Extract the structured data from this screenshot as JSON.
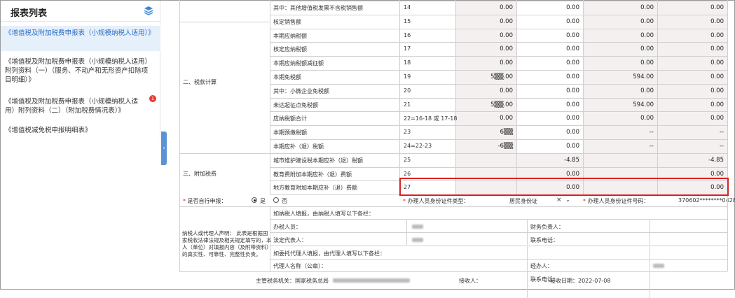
{
  "sidebar": {
    "title": "报表列表",
    "items": [
      {
        "label": "《增值税及附加税费申报表（小规模纳税人适用）》",
        "active": true
      },
      {
        "label": "《增值税及附加税费申报表（小规模纳税人适用）附列资料（一）（服务、不动产和无形资产扣除项目明细）》",
        "active": false
      },
      {
        "label": "《增值税及附加税费申报表（小规模纳税人适用）附列资料（二）（附加税费情况表）》",
        "active": false,
        "badge": "1"
      },
      {
        "label": "《增值税减免税申报明细表》",
        "active": false
      }
    ]
  },
  "form": {
    "rows": [
      {
        "label": "其中：其他增值税发票不含税销售额",
        "code": "14",
        "v1": "0.00",
        "v2": "0.00",
        "v3": "0.00",
        "v4": "0.00"
      },
      {
        "label": "核定销售额",
        "code": "15",
        "v1": "0.00",
        "v2": "0.00",
        "v3": "0.00",
        "v4": "0.00"
      },
      {
        "label": "本期应纳税额",
        "code": "16",
        "v1": "0.00",
        "v2": "0.00",
        "v3": "0.00",
        "v4": "0.00"
      },
      {
        "label": "核定应纳税额",
        "code": "17",
        "v1": "0.00",
        "v2": "0.00",
        "v3": "0.00",
        "v4": "0.00"
      },
      {
        "label": "本期应纳税额减征额",
        "code": "18",
        "v1": "0.00",
        "v2": "0.00",
        "v3": "0.00",
        "v4": "0.00"
      },
      {
        "label": "本期免税额",
        "code": "19",
        "v1": "5▒▒.00",
        "v2": "0.00",
        "v3": "594.00",
        "v4": "0.00"
      },
      {
        "label": "其中：小微企业免税额",
        "code": "20",
        "v1": "0.00",
        "v2": "0.00",
        "v3": "0.00",
        "v4": "0.00"
      },
      {
        "label": "未达起征点免税额",
        "code": "21",
        "v1": "5▒▒.00",
        "v2": "0.00",
        "v3": "594.00",
        "v4": "0.00"
      },
      {
        "label": "应纳税额合计",
        "code": "22=16-18 或 17-18",
        "v1": "0.00",
        "v2": "0.00",
        "v3": "0.00",
        "v4": "0.00"
      },
      {
        "label": "本期预缴税额",
        "code": "23",
        "v1": "6▒▒",
        "v2": "0.00",
        "v3": "--",
        "v4": "--"
      },
      {
        "label": "本期应补（退）税额",
        "code": "24=22-23",
        "v1": "-6▒▒",
        "v2": "0.00",
        "v3": "--",
        "v4": "--"
      }
    ],
    "section_tax": "二、税款计算",
    "section_extra": "三、附加税费",
    "extra_rows": [
      {
        "label": "城市维护建设税本期应补（退）税额",
        "code": "25",
        "v2": "-4.85",
        "v4": "-4.85"
      },
      {
        "label": "教育费附加本期应补（退）费额",
        "code": "26",
        "v2": "0.00",
        "v4": "0.00"
      },
      {
        "label": "地方教育附加本期应补（退）费额",
        "code": "27",
        "v2": "0.00",
        "v4": "0.00"
      }
    ],
    "self_declare_label": "是否自行申报：",
    "yes": "是",
    "no": "否",
    "id_type_label": "办理人员身份证件类型：",
    "id_type_value": "居民身份证",
    "id_no_label": "办理人员身份证件号码：",
    "id_no_value": "370602********0428",
    "declaration_text": "纳税人或代理人声明：\n此表是根据国家税收法律法规及相关规定填写的，本人（单位）对填报内容（及附带资料）的真实性、可靠性、完整性负责。",
    "taxpayer_fill": "如纳税人填报，由纳税人填写以下各栏：",
    "handler": "办税人员：",
    "finance_head": "财务负责人：",
    "legal_rep": "法定代表人：",
    "phone": "联系电话：",
    "agent_fill": "如委托代理人填报，由代理人填写以下各栏：",
    "agent_name": "代理人名称（公章）：",
    "operator": "经办人：",
    "phone2": "联系电话："
  },
  "footer": {
    "authority": "主管税务机关：国家税务总局",
    "receiver": "接收人：",
    "receive_date": "接收日期：2022-07-08"
  }
}
